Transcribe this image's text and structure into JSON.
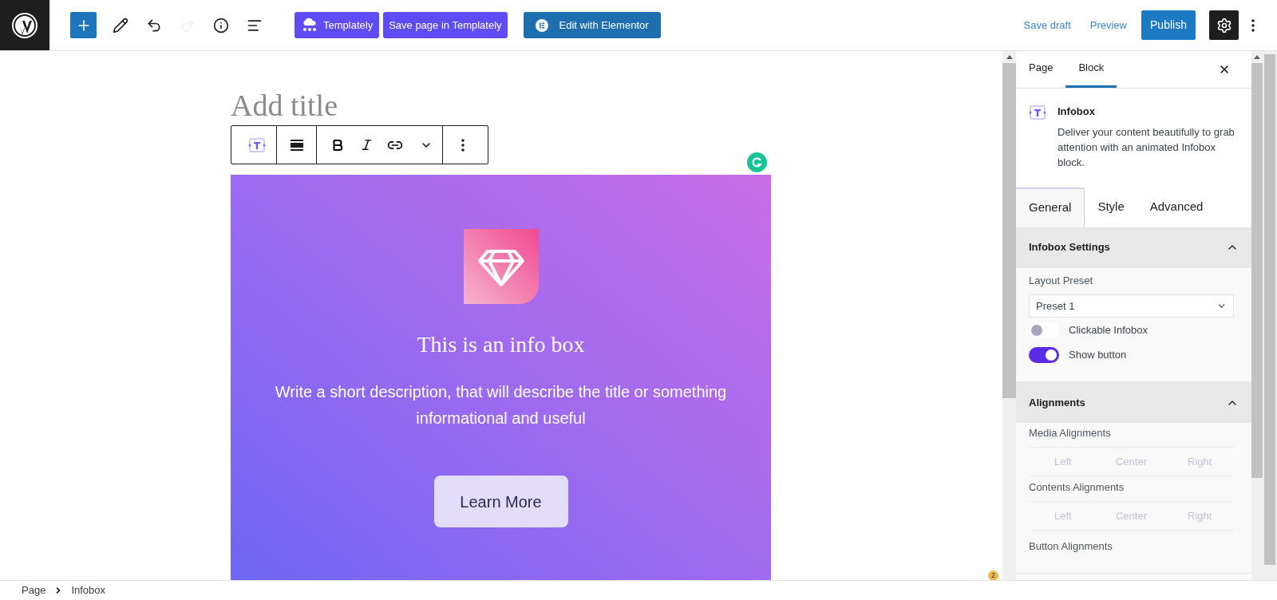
{
  "top_bar": {
    "tools": [
      {
        "kind": "add",
        "disabled": false
      },
      {
        "kind": "edit",
        "disabled": false
      },
      {
        "kind": "undo",
        "disabled": false
      },
      {
        "kind": "redo",
        "disabled": true
      },
      {
        "kind": "info",
        "disabled": false
      },
      {
        "kind": "list",
        "disabled": false
      }
    ],
    "templately_button": "Templately",
    "save_templately_button": "Save page in Templately",
    "elementor_button": "Edit with Elementor",
    "save_draft": "Save draft",
    "preview": "Preview",
    "publish": "Publish",
    "settings_active": true
  },
  "editor": {
    "title_placeholder": "Add title",
    "block_toolbar": [
      {
        "kind": "block-type"
      },
      {
        "kind": "align"
      },
      {
        "kind": "bold"
      },
      {
        "kind": "italic"
      },
      {
        "kind": "link"
      },
      {
        "kind": "more-formats"
      },
      {
        "kind": "options"
      }
    ],
    "infobox": {
      "title": "This is an info box",
      "description": "Write a short description, that will describe the title or something informational and useful",
      "button": "Learn More"
    },
    "notification_count": "2"
  },
  "sidebar": {
    "tabs": [
      {
        "label": "Page",
        "selected": false
      },
      {
        "label": "Block",
        "selected": true
      }
    ],
    "block": {
      "name": "Infobox",
      "description": "Deliver your content beautifully to grab attention with an animated Infobox block."
    },
    "inner_tabs": [
      {
        "label": "General",
        "selected": true
      },
      {
        "label": "Style",
        "selected": false
      },
      {
        "label": "Advanced",
        "selected": false
      }
    ],
    "sections": [
      {
        "title": "Infobox Settings",
        "expanded": true,
        "controls": [
          {
            "kind": "select",
            "label": "Layout Preset",
            "value": "Preset 1"
          },
          {
            "kind": "toggle",
            "label": "Clickable Infobox",
            "on": false
          },
          {
            "kind": "toggle",
            "label": "Show button",
            "on": true
          }
        ]
      },
      {
        "title": "Alignments",
        "expanded": true,
        "controls": [
          {
            "kind": "buttons",
            "label": "Media Alignments",
            "options": [
              "Left",
              "Center",
              "Right"
            ]
          },
          {
            "kind": "buttons",
            "label": "Contents Alignments",
            "options": [
              "Left",
              "Center",
              "Right"
            ]
          },
          {
            "kind": "label",
            "label": "Button Alignments"
          }
        ]
      }
    ]
  },
  "status_bar": {
    "breadcrumbs": [
      "Page",
      "Infobox"
    ]
  }
}
